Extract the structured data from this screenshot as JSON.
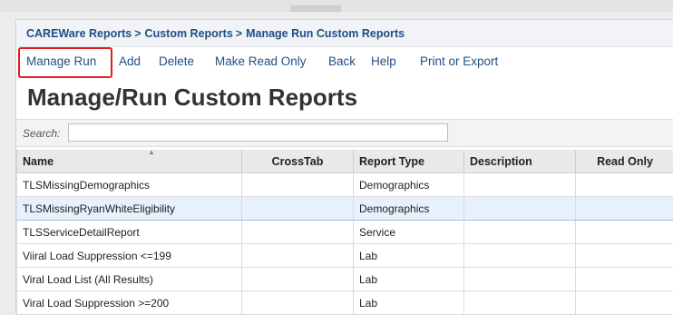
{
  "breadcrumb": {
    "items": [
      "CAREWare Reports",
      "Custom Reports",
      "Manage Run Custom Reports"
    ],
    "separator": ">"
  },
  "toolbar": {
    "items": [
      "Manage Run",
      "Add",
      "Delete",
      "Make Read Only",
      "Back",
      "Help",
      "Print or Export"
    ],
    "highlight_color": "#e31b23"
  },
  "page_title": "Manage/Run Custom Reports",
  "search": {
    "label": "Search:",
    "value": ""
  },
  "table": {
    "columns": [
      "Name",
      "CrossTab",
      "Report Type",
      "Description",
      "Read Only"
    ],
    "sort_column": "Name",
    "rows": [
      [
        "TLSMissingDemographics",
        "",
        "Demographics",
        "",
        ""
      ],
      [
        "TLSMissingRyanWhiteEligibility",
        "",
        "Demographics",
        "",
        ""
      ],
      [
        "TLSServiceDetailReport",
        "",
        "Service",
        "",
        ""
      ],
      [
        "Viiral Load Suppression <=199",
        "",
        "Lab",
        "",
        ""
      ],
      [
        "Viral Load List (All Results)",
        "",
        "Lab",
        "",
        ""
      ],
      [
        "Viral Load Suppression >=200",
        "",
        "Lab",
        "",
        ""
      ]
    ],
    "selected_row": 2
  },
  "colors": {
    "link": "#1f4f86",
    "selected_row": "#e6f1fb"
  }
}
